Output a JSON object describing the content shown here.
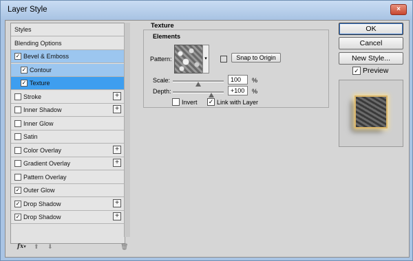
{
  "window": {
    "title": "Layer Style",
    "close_glyph": "×"
  },
  "style_list": {
    "items": [
      {
        "label": "Styles",
        "checkbox": false,
        "checked": false,
        "plus": false,
        "state": "normal",
        "indent": false
      },
      {
        "label": "Blending Options",
        "checkbox": false,
        "checked": false,
        "plus": false,
        "state": "normal",
        "indent": false
      },
      {
        "label": "Bevel & Emboss",
        "checkbox": true,
        "checked": true,
        "plus": false,
        "state": "selected-light",
        "indent": false
      },
      {
        "label": "Contour",
        "checkbox": true,
        "checked": true,
        "plus": false,
        "state": "selected-light",
        "indent": true
      },
      {
        "label": "Texture",
        "checkbox": true,
        "checked": true,
        "plus": false,
        "state": "selected",
        "indent": true
      },
      {
        "label": "Stroke",
        "checkbox": true,
        "checked": false,
        "plus": true,
        "state": "normal",
        "indent": false
      },
      {
        "label": "Inner Shadow",
        "checkbox": true,
        "checked": false,
        "plus": true,
        "state": "normal",
        "indent": false
      },
      {
        "label": "Inner Glow",
        "checkbox": true,
        "checked": false,
        "plus": false,
        "state": "normal",
        "indent": false
      },
      {
        "label": "Satin",
        "checkbox": true,
        "checked": false,
        "plus": false,
        "state": "normal",
        "indent": false
      },
      {
        "label": "Color Overlay",
        "checkbox": true,
        "checked": false,
        "plus": true,
        "state": "normal",
        "indent": false
      },
      {
        "label": "Gradient Overlay",
        "checkbox": true,
        "checked": false,
        "plus": true,
        "state": "normal",
        "indent": false
      },
      {
        "label": "Pattern Overlay",
        "checkbox": true,
        "checked": false,
        "plus": false,
        "state": "normal",
        "indent": false
      },
      {
        "label": "Outer Glow",
        "checkbox": true,
        "checked": true,
        "plus": false,
        "state": "normal",
        "indent": false
      },
      {
        "label": "Drop Shadow",
        "checkbox": true,
        "checked": true,
        "plus": true,
        "state": "normal",
        "indent": false
      },
      {
        "label": "Drop Shadow",
        "checkbox": true,
        "checked": true,
        "plus": true,
        "state": "normal",
        "indent": false
      }
    ],
    "plus_glyph": "+",
    "check_glyph": "✓",
    "bottom_bar": {
      "fx": "fx",
      "fx_caret": "▾",
      "up": "⬆",
      "down": "⬇",
      "trash": "🗑"
    }
  },
  "texture": {
    "section_title": "Texture",
    "group_title": "Elements",
    "pattern_label": "Pattern:",
    "pattern_dropdown_glyph": "▾",
    "snap_button": "Snap to Origin",
    "scale_label": "Scale:",
    "scale_value": "100",
    "scale_unit": "%",
    "scale_level": 0.5,
    "depth_label": "Depth:",
    "depth_value": "+100",
    "depth_unit": "%",
    "depth_level": 0.75,
    "invert_label": "Invert",
    "invert_checked": false,
    "link_label": "Link with Layer",
    "link_checked": true
  },
  "actions": {
    "ok": "OK",
    "cancel": "Cancel",
    "new_style": "New Style...",
    "preview_label": "Preview",
    "preview_checked": true
  },
  "colors": {
    "selected": "#3e9eef",
    "selected_light": "#9cc6ef",
    "glow": "#f3dc9a"
  }
}
